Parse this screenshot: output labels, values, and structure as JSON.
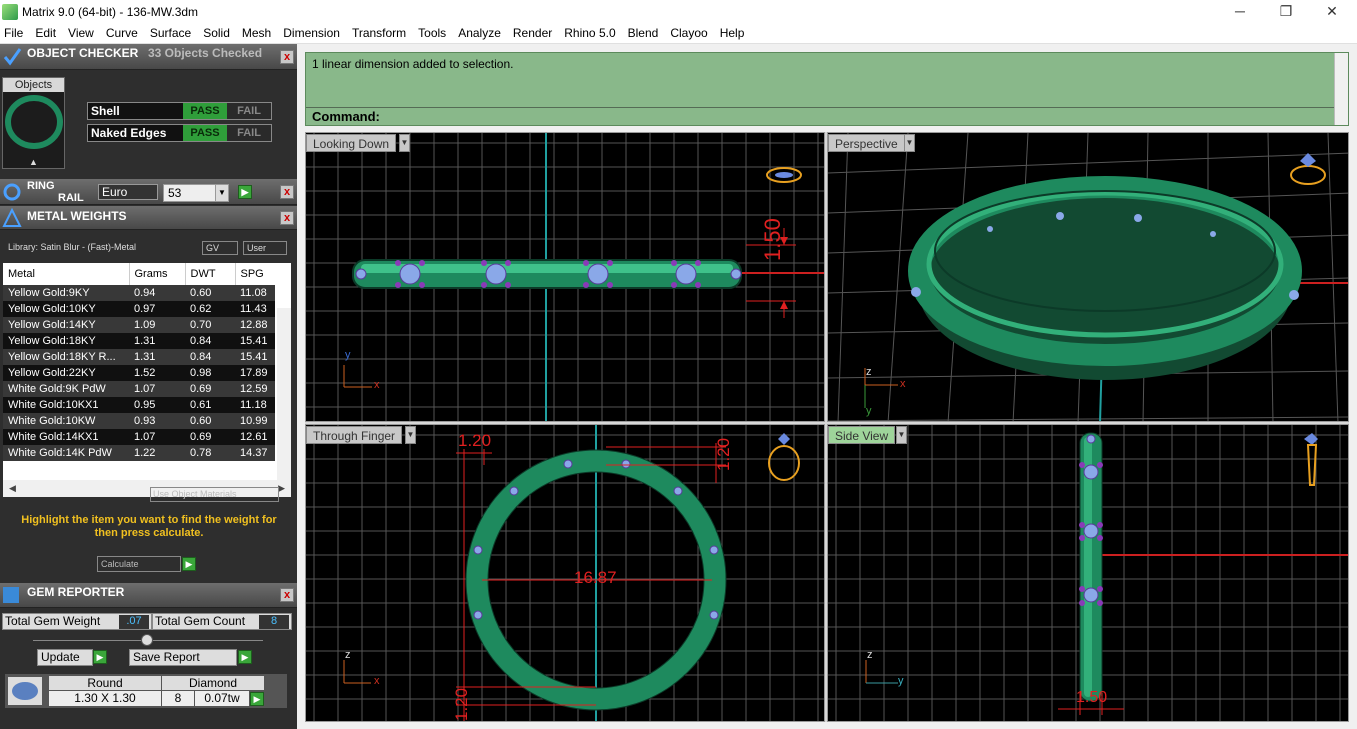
{
  "window": {
    "title": "Matrix 9.0 (64-bit) - 136-MW.3dm",
    "minimize": "─",
    "restore": "❐",
    "close": "✕"
  },
  "menu": [
    "File",
    "Edit",
    "View",
    "Curve",
    "Surface",
    "Solid",
    "Mesh",
    "Dimension",
    "Transform",
    "Tools",
    "Analyze",
    "Render",
    "Rhino 5.0",
    "Blend",
    "Clayoo",
    "Help"
  ],
  "object_checker": {
    "title": "OBJECT CHECKER",
    "checked": "33  Objects Checked",
    "objects_label": "Objects",
    "checks": [
      {
        "label": "Shell",
        "pass": "PASS",
        "fail": "FAIL"
      },
      {
        "label": "Naked Edges",
        "pass": "PASS",
        "fail": "FAIL"
      }
    ]
  },
  "ring_rail": {
    "title1": "RING",
    "title2": "RAIL",
    "standard": "Euro",
    "size": "53"
  },
  "metal_weights": {
    "title": "METAL WEIGHTS",
    "library": "Library: Satin Blur - (Fast)-Metal",
    "gv": "GV",
    "user": "User",
    "columns": [
      "Metal",
      "Grams",
      "DWT",
      "SPG"
    ],
    "rows": [
      [
        "Yellow Gold:9KY",
        "0.94",
        "0.60",
        "11.08"
      ],
      [
        "Yellow Gold:10KY",
        "0.97",
        "0.62",
        "11.43"
      ],
      [
        "Yellow Gold:14KY",
        "1.09",
        "0.70",
        "12.88"
      ],
      [
        "Yellow Gold:18KY",
        "1.31",
        "0.84",
        "15.41"
      ],
      [
        "Yellow Gold:18KY R...",
        "1.31",
        "0.84",
        "15.41"
      ],
      [
        "Yellow Gold:22KY",
        "1.52",
        "0.98",
        "17.89"
      ],
      [
        "White Gold:9K PdW",
        "1.07",
        "0.69",
        "12.59"
      ],
      [
        "White Gold:10KX1",
        "0.95",
        "0.61",
        "11.18"
      ],
      [
        "White Gold:10KW",
        "0.93",
        "0.60",
        "10.99"
      ],
      [
        "White Gold:14KX1",
        "1.07",
        "0.69",
        "12.61"
      ],
      [
        "White Gold:14K PdW",
        "1.22",
        "0.78",
        "14.37"
      ]
    ],
    "use_object_materials": "Use Object Materials",
    "hint": "Highlight the item you want to find the weight for then press calculate.",
    "calculate": "Calculate"
  },
  "gem_reporter": {
    "title": "GEM REPORTER",
    "total_weight_label": "Total Gem Weight",
    "total_weight": ".07",
    "total_count_label": "Total Gem Count",
    "total_count": "8",
    "update": "Update",
    "save_report": "Save Report",
    "shape": "Round",
    "size": "1.30 X 1.30",
    "material": "Diamond",
    "count": "8",
    "tw": "0.07tw"
  },
  "command": {
    "history": "1 linear dimension added to selection.",
    "prompt": "Command:"
  },
  "viewports": {
    "top": {
      "label": "Looking Down",
      "dim": "1.50"
    },
    "persp": {
      "label": "Perspective"
    },
    "front": {
      "label": "Through Finger",
      "dims": [
        "1.20",
        "1.20",
        "16.87",
        "1.20"
      ]
    },
    "right": {
      "label": "Side View",
      "dim": "1.50"
    }
  },
  "axes": {
    "x": "x",
    "y": "y",
    "z": "z"
  },
  "colors": {
    "ring": "#1e8a5e",
    "dim": "#e02020",
    "axis": "#20a0a0",
    "grid": "#555555"
  }
}
